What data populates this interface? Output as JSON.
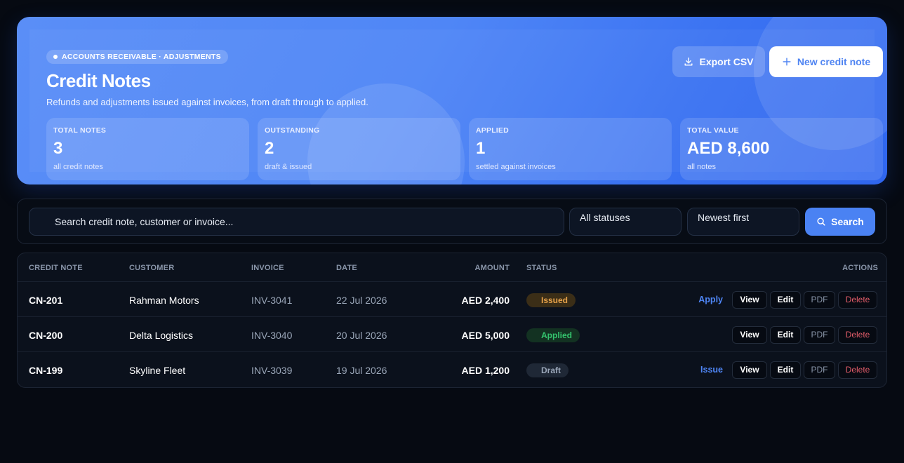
{
  "hero": {
    "eyebrow": "ACCOUNTS RECEIVABLE · ADJUSTMENTS",
    "title": "Credit Notes",
    "subtitle": "Refunds and adjustments issued against invoices, from draft through to applied.",
    "export_label": "Export CSV",
    "export_icon": "download-icon",
    "new_label": "New credit note",
    "new_icon": "plus-icon",
    "accent_color": "#4f86f6"
  },
  "stats": [
    {
      "label": "TOTAL NOTES",
      "value": "3",
      "note": "all credit notes"
    },
    {
      "label": "OUTSTANDING",
      "value": "2",
      "note": "draft & issued"
    },
    {
      "label": "APPLIED",
      "value": "1",
      "note": "settled against invoices"
    },
    {
      "label": "TOTAL VALUE",
      "value": "AED 8,600",
      "note": "all notes"
    }
  ],
  "filters": {
    "search_placeholder": "Search credit note, customer or invoice...",
    "status_selected": "All statuses",
    "sort_selected": "Newest first",
    "search_button": "Search",
    "search_icon": "search-icon"
  },
  "table": {
    "columns": {
      "note": "CREDIT NOTE",
      "customer": "CUSTOMER",
      "invoice": "INVOICE",
      "date": "DATE",
      "amount": "AMOUNT",
      "status": "STATUS",
      "actions": "ACTIONS"
    },
    "rows": [
      {
        "note": "CN-201",
        "customer": "Rahman Motors",
        "invoice": "INV-3041",
        "date": "22 Jul 2026",
        "amount": "AED 2,400",
        "status": "Issued",
        "link": "Apply"
      },
      {
        "note": "CN-200",
        "customer": "Delta Logistics",
        "invoice": "INV-3040",
        "date": "20 Jul 2026",
        "amount": "AED 5,000",
        "status": "Applied",
        "link": ""
      },
      {
        "note": "CN-199",
        "customer": "Skyline Fleet",
        "invoice": "INV-3039",
        "date": "19 Jul 2026",
        "amount": "AED 1,200",
        "status": "Draft",
        "link": "Issue"
      }
    ],
    "actions": {
      "view": "View",
      "edit": "Edit",
      "pdf": "PDF",
      "delete": "Delete"
    }
  },
  "status_colors": {
    "Issued": "#e7a24a",
    "Applied": "#34c36d",
    "Draft": "#9aa6b8"
  }
}
